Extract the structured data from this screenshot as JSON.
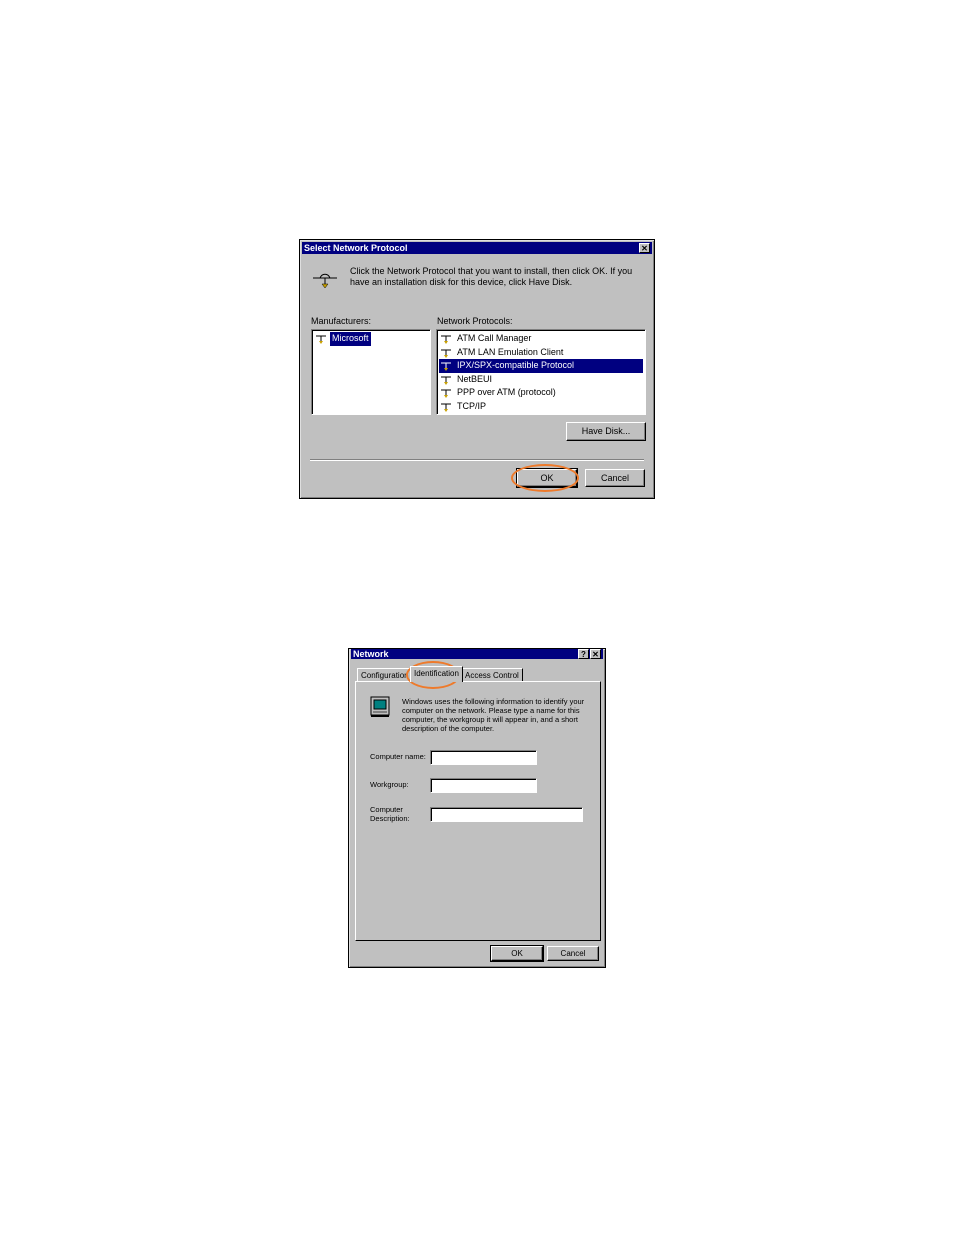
{
  "dialog1": {
    "title": "Select Network Protocol",
    "close_glyph": "✕",
    "instruction": "Click the Network Protocol that you want to install, then click OK. If you have an installation disk for this device, click Have Disk.",
    "manufacturers_label": "Manufacturers:",
    "manufacturers": [
      "Microsoft"
    ],
    "protocols_label": "Network Protocols:",
    "protocols": [
      "ATM Call Manager",
      "ATM LAN Emulation Client",
      "IPX/SPX-compatible Protocol",
      "NetBEUI",
      "PPP over ATM (protocol)",
      "TCP/IP"
    ],
    "selected_protocol": "IPX/SPX-compatible Protocol",
    "have_disk_label": "Have Disk...",
    "ok_label": "OK",
    "cancel_label": "Cancel",
    "icon": "network-protocol-icon"
  },
  "dialog2": {
    "title": "Network",
    "help_glyph": "?",
    "close_glyph": "✕",
    "tabs": [
      "Configuration",
      "Identification",
      "Access Control"
    ],
    "active_tab": "Identification",
    "info_text": "Windows uses the following information to identify your computer on the network. Please type a name for this computer, the workgroup it will appear in, and a short description of the computer.",
    "computer_name_label": "Computer name:",
    "workgroup_label": "Workgroup:",
    "description_label": "Computer Description:",
    "computer_name_value": "",
    "workgroup_value": "",
    "description_value": "",
    "ok_label": "OK",
    "cancel_label": "Cancel",
    "icon": "computer-identification-icon"
  },
  "colors": {
    "highlight": "#ee7a2b",
    "titlebar": "#000080",
    "dialog_face": "#c0c0c0"
  }
}
